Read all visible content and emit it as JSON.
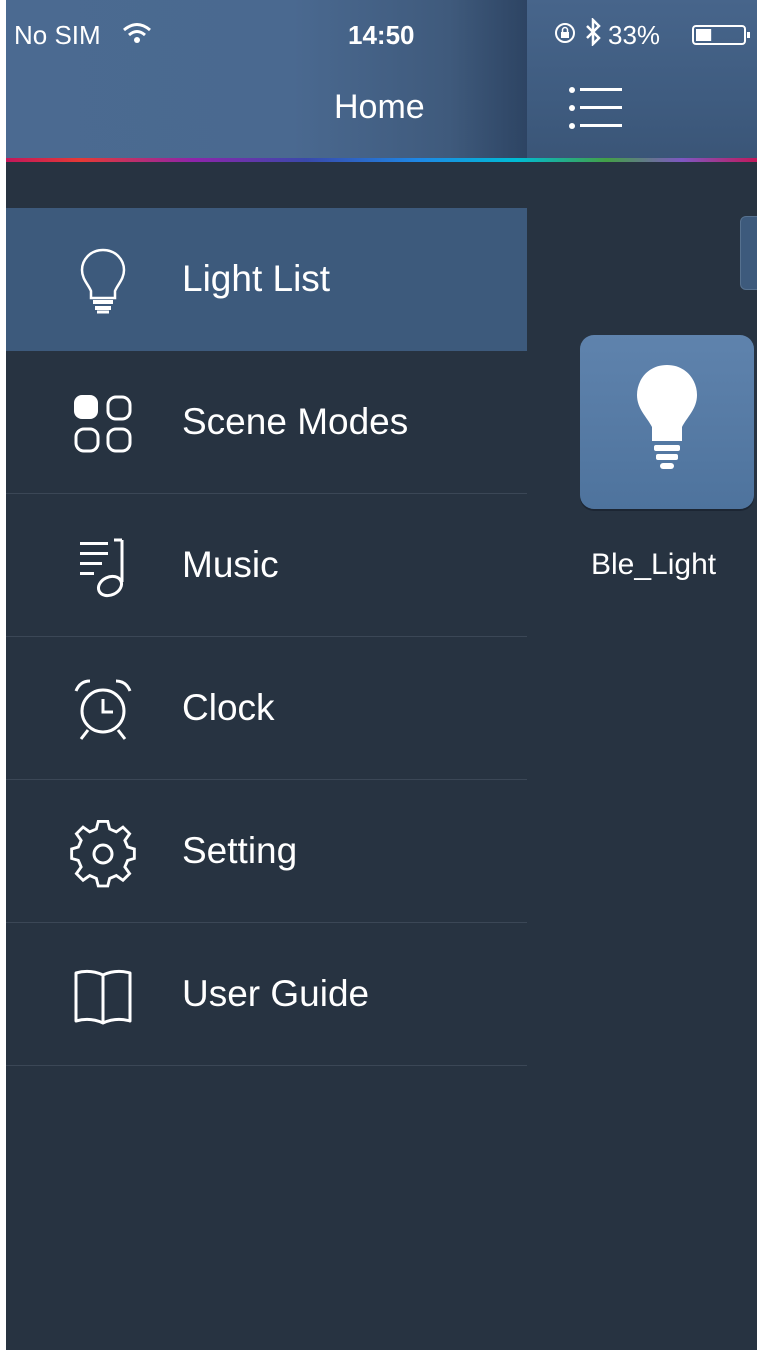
{
  "status_bar": {
    "carrier": "No SIM",
    "time": "14:50",
    "battery_percent": "33%",
    "battery_level": 0.33
  },
  "header": {
    "title": "Home",
    "menu_icon": "list-menu-icon"
  },
  "sidebar": {
    "items": [
      {
        "label": "Light List",
        "icon": "lightbulb-icon",
        "active": true
      },
      {
        "label": "Scene Modes",
        "icon": "grid-icon",
        "active": false
      },
      {
        "label": "Music",
        "icon": "music-note-icon",
        "active": false
      },
      {
        "label": "Clock",
        "icon": "alarm-clock-icon",
        "active": false
      },
      {
        "label": "Setting",
        "icon": "gear-icon",
        "active": false
      },
      {
        "label": "User Guide",
        "icon": "book-icon",
        "active": false
      }
    ]
  },
  "main": {
    "lights": [
      {
        "name": "Ble_Light",
        "icon": "lightbulb-filled-icon"
      }
    ]
  },
  "colors": {
    "background": "#273341",
    "header": "#4a6990",
    "active_item": "#3d5a7c",
    "tile": "#5a7ea8"
  }
}
